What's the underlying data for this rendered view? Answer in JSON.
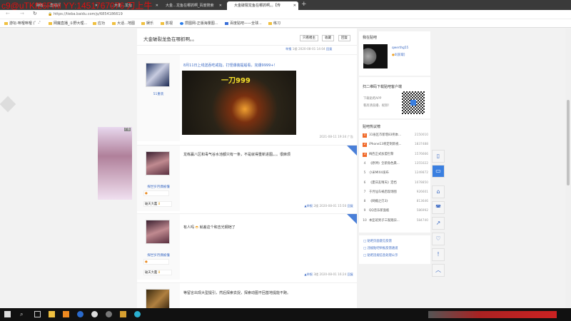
{
  "browser": {
    "tabs": [
      {
        "label": "网络……直播间"
      },
      {
        "label": "…大金…龙鱼"
      },
      {
        "label": "大金…龙鱼在哪抓啊_百度搜索"
      },
      {
        "label": "大金破裂龙鱼在哪抓啊。。【传"
      }
    ],
    "url": "https://tieba.baidu.com/p/6854186619",
    "watermark": "c9@uTKf26Fmi  YY:1451767076  刀上牛",
    "bookmarks": [
      "游坛-咪哩咪哩 (゜-゜",
      "网魔直播_斗野大理...",
      "应功",
      "大话…地图",
      "娱乐",
      "影视",
      "攒图网-正版海量图...",
      "百度贴吧——全球...",
      "练习"
    ]
  },
  "thread": {
    "title": "大金破裂龙鱼在哪抓啊。。",
    "buttons": {
      "only_op": "只看楼主",
      "collect": "收藏",
      "reply": "回复"
    },
    "first_meta": {
      "report": "举报",
      "floor": "1楼",
      "time": "2020-08-01 14:04",
      "reply": "回复"
    },
    "ad": {
      "user": "51重装",
      "text": "8月11日上线送吞吃戒指，打怪爆装提船看，完爆9999+！",
      "banner": "一刀999",
      "time": "2021-08-11 19:34",
      "tag": "广告"
    },
    "posts": [
      {
        "user": "探世岁月偶被懂",
        "rank": "破天大蠢",
        "level": "8",
        "text": "龙练赢八区和毒气谷水池都只有一条，不是就得重新进图。。。很麻烦",
        "report": "举报",
        "floor": "2楼",
        "time": "2020-08-01 15:50",
        "reply": "回复"
      },
      {
        "user": "探世岁月偶被懂",
        "rank": "破天大蠢",
        "level": "8",
        "text": "有人吗",
        "text2": "就差这个和吉光钢铠了",
        "report": "举报",
        "floor": "3楼",
        "time": "2020-08-01 16:24",
        "reply": "回复"
      },
      {
        "text": "等留言出现大型提引，然后探索去捉，探索动图不回基地提能不跑。"
      }
    ]
  },
  "sidebar": {
    "my_tieba": "我在贴吧",
    "username": "qwerthg55",
    "rank_link": "0[获取]",
    "qr_title": "扫二维码下载贴吧客户端",
    "qr_line1": "下载贴吧APP",
    "qr_line2": "看高清直播、视频！",
    "hot_title": "贴吧热议榜",
    "hot": [
      {
        "n": "1",
        "t": "31省区市新增83例本...",
        "v": "2150010"
      },
      {
        "n": "2",
        "t": "iPhone13将定制新视...",
        "v": "1837488"
      },
      {
        "n": "3",
        "t": "梅西正式加盟巴黎",
        "v": "1576666"
      },
      {
        "n": "4",
        "t": "《原神》全新角色典...",
        "v": "1355022"
      },
      {
        "n": "5",
        "t": "小米MIX4发布",
        "v": "1249872"
      },
      {
        "n": "6",
        "t": "《夏日友晴天》定档",
        "v": "1078850"
      },
      {
        "n": "7",
        "t": "于月仙车祸后现场图",
        "v": "926601"
      },
      {
        "n": "8",
        "t": "《网瘾之刃3》",
        "v": "813646"
      },
      {
        "n": "9",
        "t": "QQ音乐新面板",
        "v": "586992"
      },
      {
        "n": "10",
        "t": "本亚班男子三观跑旧...",
        "v": "584740"
      }
    ],
    "links": [
      "贴吧页面意见反馈",
      "违规贴吧举报反馈通道",
      "贴吧违规信息处理公示"
    ]
  },
  "ad_left_tag": "广告"
}
